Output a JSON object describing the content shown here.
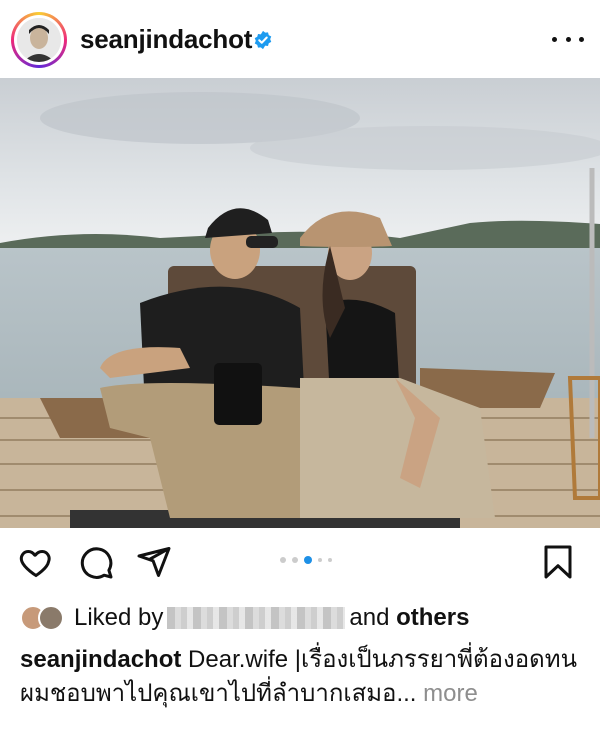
{
  "post": {
    "username": "seanjindachot",
    "verified_icon": "verified-badge-icon",
    "more_icon": "more-options-icon"
  },
  "colors": {
    "verified": "#1d9bf0",
    "carousel_active": "#1e90e6",
    "carousel_inactive": "#cccccc",
    "more_text": "#8e8e8e"
  },
  "actions": {
    "like_icon": "heart-icon",
    "comment_icon": "comment-icon",
    "share_icon": "send-icon",
    "save_icon": "bookmark-icon"
  },
  "carousel": {
    "total": 5,
    "active_index": 2
  },
  "likes": {
    "prefix": "Liked by",
    "connector": "and",
    "others": "others"
  },
  "caption": {
    "username": "seanjindachot",
    "line1": "Dear.wife |เรื่องเป็นภรรยาพี่ต้องอดทน",
    "line2": "ผมชอบพาไปคุณเขาไปที่ลำบากเสมอ...",
    "more": "more"
  }
}
